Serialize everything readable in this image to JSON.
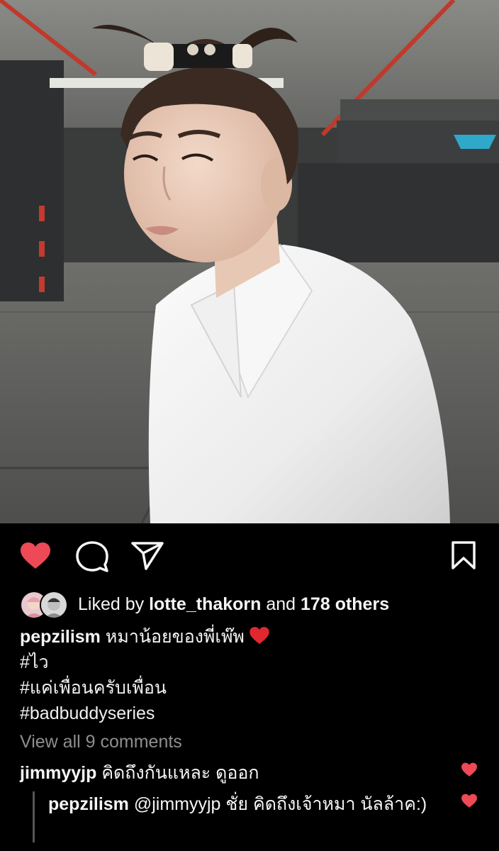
{
  "post": {
    "photo_alt": "",
    "colors": {
      "background": "#000000",
      "like_red": "#ed4956",
      "muted_text": "#8e8e8e"
    }
  },
  "actions": {
    "like_icon": "heart-filled-icon",
    "comment_icon": "speech-bubble-icon",
    "share_icon": "paper-plane-icon",
    "save_icon": "bookmark-icon"
  },
  "likes": {
    "prefix": "Liked by ",
    "user": "lotte_thakorn",
    "middle": " and ",
    "count_text": "178 others"
  },
  "caption": {
    "user": "pepzilism",
    "text": " หมาน้อยของพี่เพ๊พ",
    "emoji": "heart-emoji",
    "tags": [
      "#ไว",
      "#แค่เพื่อนครับเพื่อน",
      "#badbuddyseries"
    ]
  },
  "view_all_comments": "View all 9 comments",
  "comments": [
    {
      "user": "jimmyyjp",
      "text": " คิดถึงกันแหละ ดูออก"
    }
  ],
  "reply": {
    "user": "pepzilism",
    "text": " @jimmyyjp ชั่ย คิดถึงเจ้าหมา นัลล้าค:)"
  }
}
